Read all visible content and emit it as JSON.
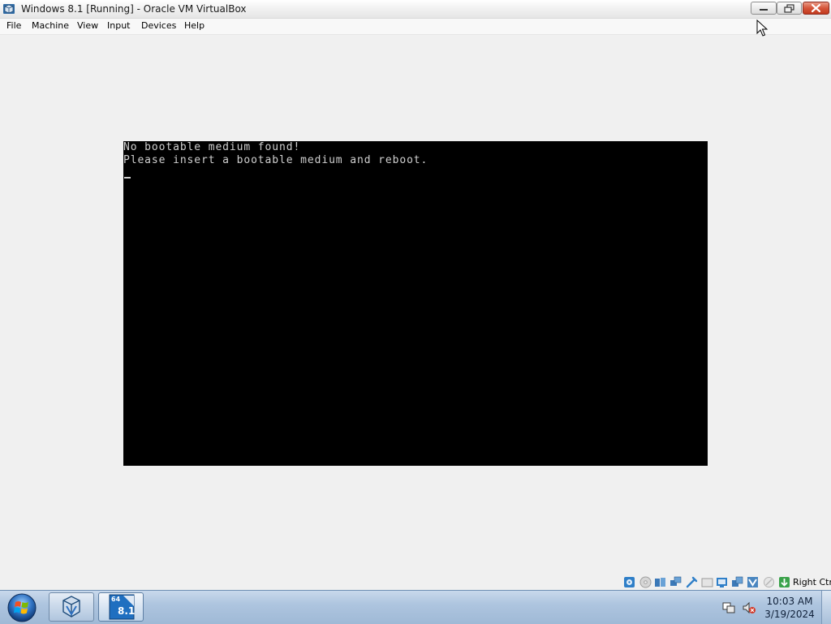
{
  "window": {
    "title": "Windows 8.1 [Running] - Oracle VM VirtualBox",
    "icon": "virtualbox-icon"
  },
  "menubar": {
    "items": [
      "File",
      "Machine",
      "View",
      "Input",
      "Devices",
      "Help"
    ]
  },
  "vm_console": {
    "lines": [
      "No bootable medium found!",
      "Please insert a bootable medium and reboot."
    ],
    "cursor": "_"
  },
  "statusbar": {
    "icons": [
      "hard-disk-icon",
      "optical-drive-icon",
      "audio-icon",
      "network-icon",
      "usb-icon",
      "shared-folders-icon",
      "display-icon",
      "video-capture-icon",
      "cpu-icon",
      "virtualization-icon",
      "mouse-integration-icon",
      "host-key-arrow-icon"
    ],
    "host_key": "Right Ctrl"
  },
  "taskbar": {
    "buttons": [
      {
        "name": "virtualbox-manager",
        "label": ""
      },
      {
        "name": "windows-8-1-vm",
        "label": "8.1",
        "badge": "64"
      }
    ],
    "clock": {
      "time": "10:03 AM",
      "date": "3/19/2024"
    }
  },
  "colors": {
    "console_bg": "#000000",
    "console_text": "#cfcfcf",
    "workspace_bg": "#f0f0f0",
    "close_button": "#d5553a"
  }
}
